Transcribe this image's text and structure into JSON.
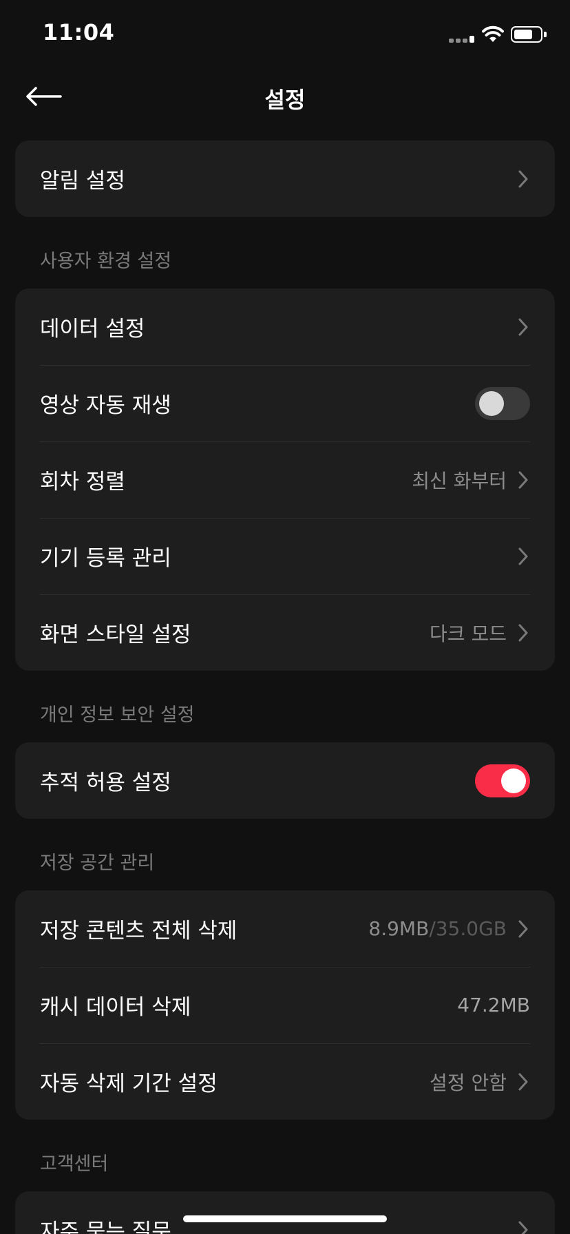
{
  "status_bar": {
    "time": "11:04"
  },
  "header": {
    "title": "설정"
  },
  "notification": {
    "label": "알림 설정"
  },
  "sections": {
    "user_pref": {
      "title": "사용자 환경 설정",
      "data_settings": "데이터 설정",
      "autoplay": "영상 자동 재생",
      "episode_sort": "회차 정렬",
      "episode_sort_value": "최신 화부터",
      "device_mgmt": "기기 등록 관리",
      "screen_style": "화면 스타일 설정",
      "screen_style_value": "다크 모드"
    },
    "privacy": {
      "title": "개인 정보 보안 설정",
      "tracking": "추적 허용 설정"
    },
    "storage": {
      "title": "저장 공간 관리",
      "delete_all": "저장 콘텐츠 전체 삭제",
      "used": "8.9MB",
      "total": "/35.0GB",
      "cache_delete": "캐시 데이터 삭제",
      "cache_value": "47.2MB",
      "auto_delete": "자동 삭제 기간 설정",
      "auto_delete_value": "설정 안함"
    },
    "support": {
      "title": "고객센터",
      "faq": "자주 묻는 질문"
    }
  },
  "toggles": {
    "autoplay_on": false,
    "tracking_on": true
  },
  "colors": {
    "accent": "#fa2d48",
    "background": "#111111",
    "card": "#1e1e1e"
  }
}
